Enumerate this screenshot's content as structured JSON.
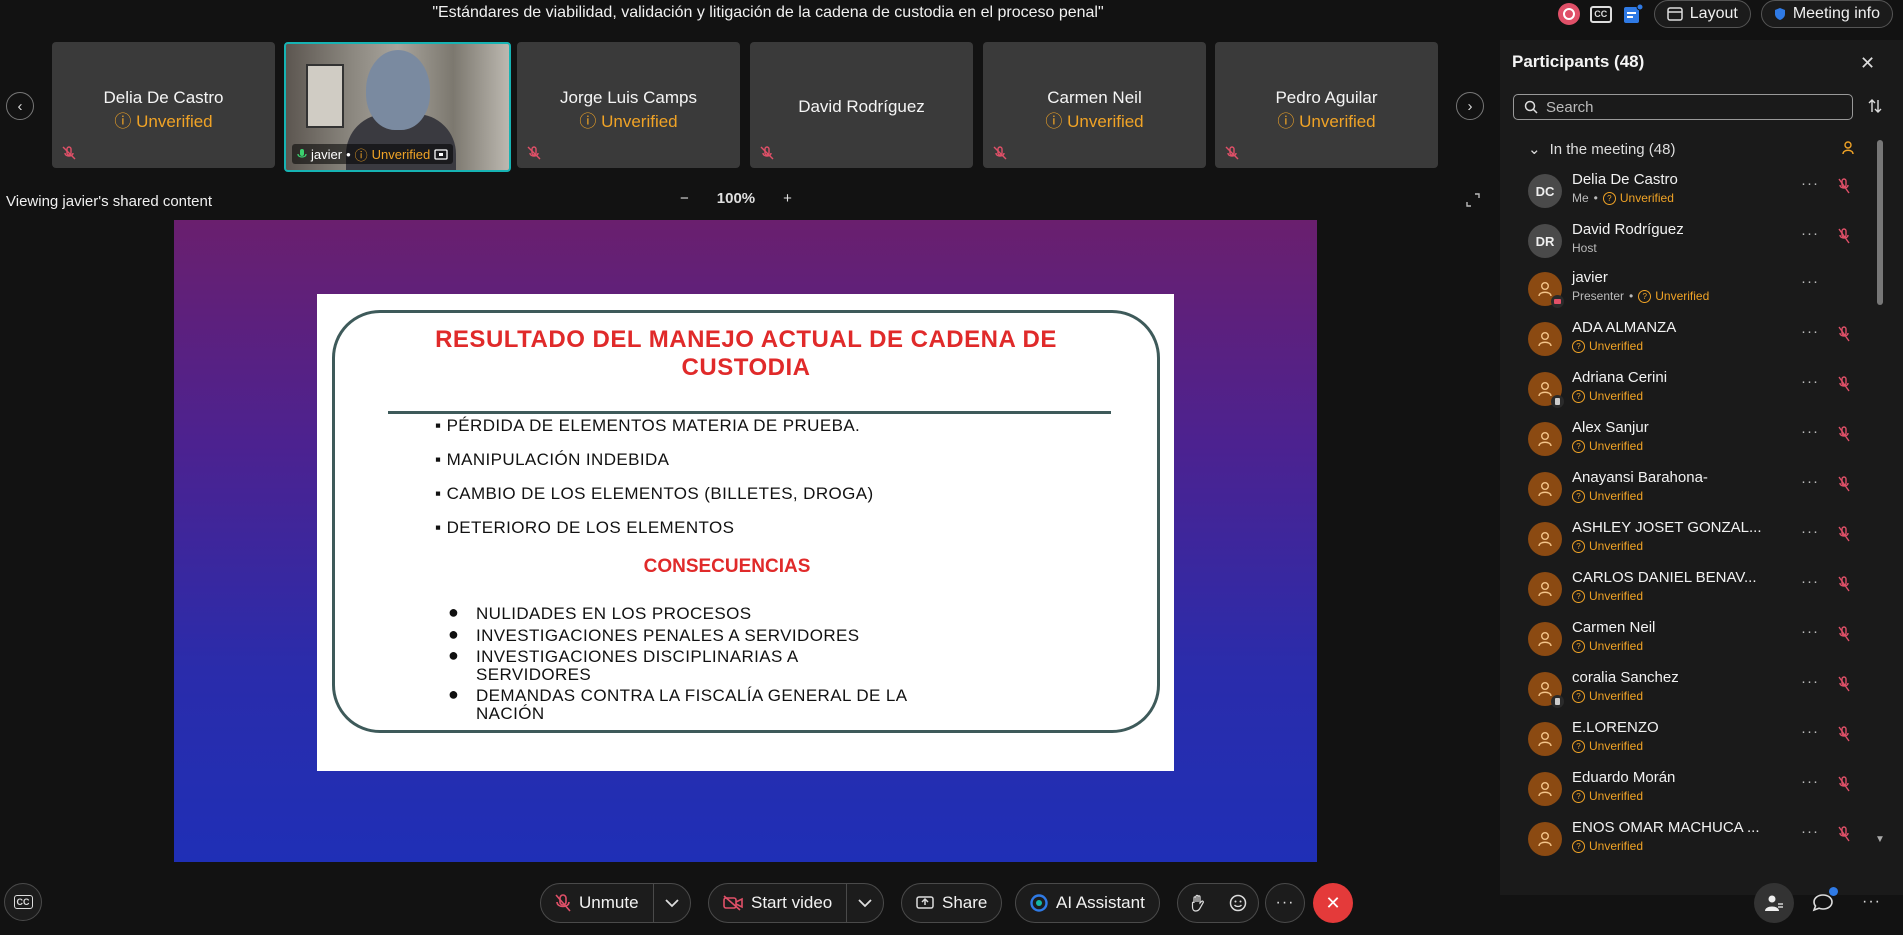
{
  "meeting": {
    "title": "\"Estándares de viabilidad, validación y litigación de la cadena de custodia en el proceso penal\"",
    "layout_label": "Layout",
    "info_label": "Meeting info",
    "cc_label": "CC"
  },
  "thumbnails": [
    {
      "name": "Delia De Castro",
      "status": "Unverified"
    },
    {
      "name": "javier",
      "status": "Unverified",
      "video": true
    },
    {
      "name": "Jorge Luis Camps",
      "status": "Unverified"
    },
    {
      "name": "David Rodríguez",
      "status": ""
    },
    {
      "name": "Carmen Neil",
      "status": "Unverified"
    },
    {
      "name": "Pedro Aguilar",
      "status": "Unverified"
    }
  ],
  "viewer": {
    "label": "Viewing javier's shared content",
    "zoom": "100%"
  },
  "slide": {
    "title_line1": "RESULTADO DEL MANEJO ACTUAL DE CADENA DE",
    "title_line2": "CUSTODIA",
    "bullets": [
      "PÉRDIDA DE ELEMENTOS MATERIA DE PRUEBA.",
      "MANIPULACIÓN INDEBIDA",
      "CAMBIO DE LOS ELEMENTOS (BILLETES, DROGA)",
      "DETERIORO DE LOS ELEMENTOS"
    ],
    "subtitle": "CONSECUENCIAS",
    "consequences": [
      [
        "NULIDADES EN LOS PROCESOS"
      ],
      [
        "INVESTIGACIONES PENALES A SERVIDORES"
      ],
      [
        "INVESTIGACIONES DISCIPLINARIAS A",
        "SERVIDORES"
      ],
      [
        "DEMANDAS CONTRA LA FISCALÍA GENERAL DE LA",
        "NACIÓN"
      ]
    ]
  },
  "participants_panel": {
    "title": "Participants (48)",
    "search_placeholder": "Search",
    "section": "In the meeting (48)",
    "participants": [
      {
        "name": "Delia De Castro",
        "initials": "DC",
        "role": "Me",
        "status": "Unverified"
      },
      {
        "name": "David Rodríguez",
        "initials": "DR",
        "role": "Host",
        "status": ""
      },
      {
        "name": "javier",
        "initials": "",
        "role": "Presenter",
        "status": "Unverified"
      },
      {
        "name": "ADA ALMANZA",
        "initials": "",
        "role": "",
        "status": "Unverified"
      },
      {
        "name": "Adriana Cerini",
        "initials": "",
        "role": "",
        "status": "Unverified"
      },
      {
        "name": "Alex Sanjur",
        "initials": "",
        "role": "",
        "status": "Unverified"
      },
      {
        "name": "Anayansi Barahona-",
        "initials": "",
        "role": "",
        "status": "Unverified"
      },
      {
        "name": "ASHLEY JOSET GONZAL...",
        "initials": "",
        "role": "",
        "status": "Unverified"
      },
      {
        "name": "CARLOS DANIEL BENAV...",
        "initials": "",
        "role": "",
        "status": "Unverified"
      },
      {
        "name": "Carmen Neil",
        "initials": "",
        "role": "",
        "status": "Unverified"
      },
      {
        "name": "coralia Sanchez",
        "initials": "",
        "role": "",
        "status": "Unverified"
      },
      {
        "name": "E.LORENZO",
        "initials": "",
        "role": "",
        "status": "Unverified"
      },
      {
        "name": "Eduardo Morán",
        "initials": "",
        "role": "",
        "status": "Unverified"
      },
      {
        "name": "ENOS OMAR MACHUCA ...",
        "initials": "",
        "role": "",
        "status": "Unverified"
      }
    ]
  },
  "controls": {
    "unmute": "Unmute",
    "start_video": "Start video",
    "share": "Share",
    "ai_assistant": "AI Assistant"
  },
  "colors": {
    "accent_unverified": "#f0a326",
    "leave_red": "#e43a3a",
    "active_border": "#16b3b3",
    "slide_title_red": "#e02a2a"
  }
}
